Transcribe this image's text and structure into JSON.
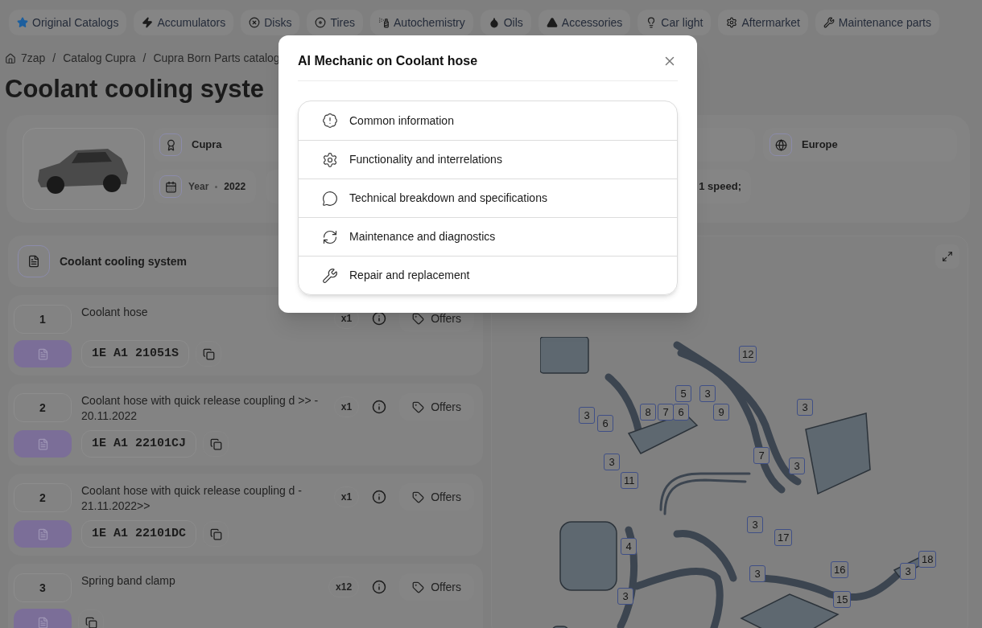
{
  "nav_tabs": [
    {
      "label": "Original Catalogs",
      "kind": "star"
    },
    {
      "label": "Accumulators",
      "kind": "bolt"
    },
    {
      "label": "Disks",
      "kind": "disk"
    },
    {
      "label": "Tires",
      "kind": "tire"
    },
    {
      "label": "Autochemistry",
      "kind": "spray"
    },
    {
      "label": "Oils",
      "kind": "drop"
    },
    {
      "label": "Accessories",
      "kind": "cone"
    },
    {
      "label": "Car light",
      "kind": "bulb"
    },
    {
      "label": "Aftermarket",
      "kind": "gear"
    },
    {
      "label": "Maintenance parts",
      "kind": "wrench"
    }
  ],
  "breadcrumbs": [
    "7zap",
    "Catalog Cupra",
    "Cupra Born Parts catalog"
  ],
  "breadcrumb_separator": "/",
  "page_title": "Coolant cooling syste",
  "vehicle": {
    "brand": "Cupra",
    "year_label": "Year",
    "year": "2022",
    "engine_tail": "1 speed;",
    "region": "Europe"
  },
  "parts_panel": {
    "title": "Coolant cooling system"
  },
  "parts": [
    {
      "number": "1",
      "name": "Coolant hose",
      "qty": "x1",
      "offers": "Offers",
      "part_number": "1E A1 21051S"
    },
    {
      "number": "2",
      "name": "Coolant hose with quick release coupling d >> - 20.11.2022",
      "qty": "x1",
      "offers": "Offers",
      "part_number": "1E A1 22101CJ"
    },
    {
      "number": "2",
      "name": "Coolant hose with quick release coupling d - 21.11.2022>>",
      "qty": "x1",
      "offers": "Offers",
      "part_number": "1E A1 22101DC"
    },
    {
      "number": "3",
      "name": "Spring band clamp",
      "qty": "x12",
      "offers": "Offers"
    }
  ],
  "diagram": {
    "callouts": [
      "12",
      "5",
      "3",
      "8",
      "7",
      "6",
      "9",
      "3",
      "6",
      "3",
      "7",
      "3",
      "3",
      "11",
      "3",
      "17",
      "4",
      "3",
      "16",
      "3",
      "18",
      "15",
      "3"
    ]
  },
  "modal": {
    "title": "AI Mechanic on Coolant hose",
    "items": [
      {
        "label": "Common information",
        "kind": "info"
      },
      {
        "label": "Functionality and interrelations",
        "kind": "function"
      },
      {
        "label": "Technical breakdown and specifications",
        "kind": "technical"
      },
      {
        "label": "Maintenance and diagnostics",
        "kind": "maintenance"
      },
      {
        "label": "Repair and replacement",
        "kind": "repair"
      }
    ]
  }
}
